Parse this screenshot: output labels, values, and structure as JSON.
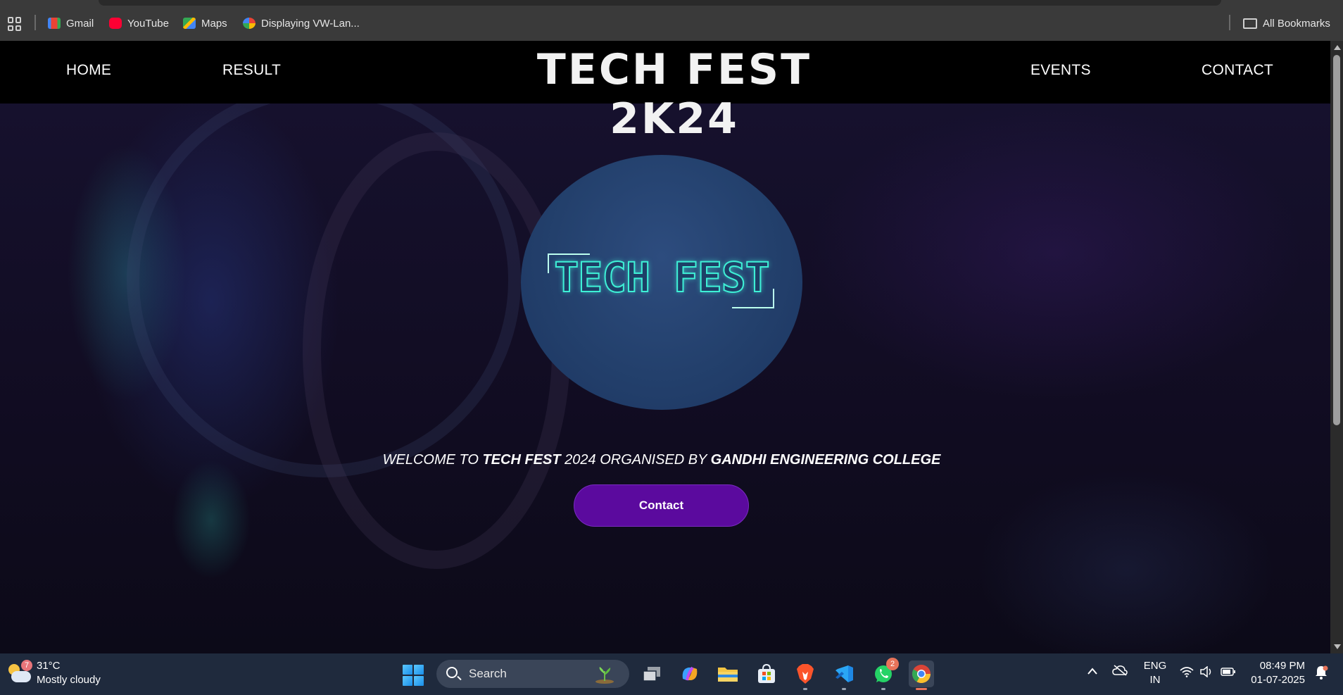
{
  "bookmarks": {
    "items": [
      {
        "label": "Gmail",
        "icon": "gmail-icon"
      },
      {
        "label": "YouTube",
        "icon": "youtube-icon"
      },
      {
        "label": "Maps",
        "icon": "maps-icon"
      },
      {
        "label": "Displaying VW-Lan...",
        "icon": "photos-icon"
      }
    ],
    "all_bookmarks": "All Bookmarks"
  },
  "site": {
    "nav": {
      "home": "HOME",
      "result": "RESULT",
      "events": "EVENTS",
      "contact": "CONTACT"
    },
    "brand": "TECH FEST 2K24",
    "logo_text": "TECH FEST",
    "welcome": {
      "part1": "WELCOME TO ",
      "bold1": "TECH FEST",
      "part2": " 2024 ORGANISED BY ",
      "bold2": "GANDHI ENGINEERING COLLEGE"
    },
    "contact_button": "Contact"
  },
  "taskbar": {
    "weather": {
      "temp": "31°C",
      "condition": "Mostly cloudy",
      "badge": "7"
    },
    "search_placeholder": "Search",
    "apps": [
      "task-view",
      "copilot",
      "file-explorer",
      "microsoft-store",
      "brave",
      "vscode",
      "whatsapp",
      "chrome"
    ],
    "whatsapp_badge": "2",
    "lang": {
      "line1": "ENG",
      "line2": "IN"
    },
    "clock": {
      "time": "08:49 PM",
      "date": "01-07-2025"
    }
  },
  "colors": {
    "accent_button": "#5b0a9e",
    "logo_glow": "#3ef0d6",
    "navbar": "#000000",
    "taskbar": "#1f2a3d"
  }
}
